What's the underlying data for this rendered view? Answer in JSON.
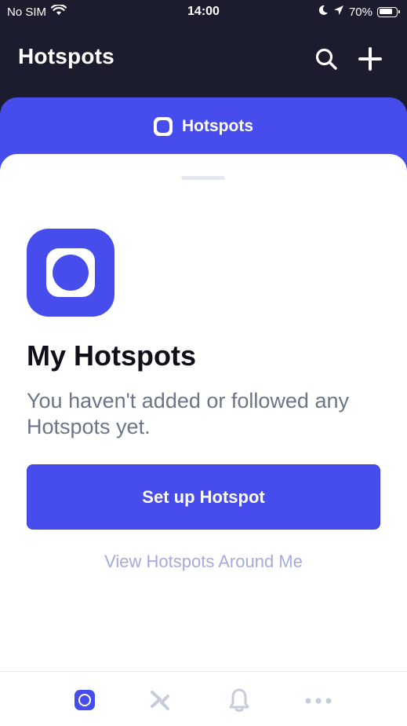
{
  "status_bar": {
    "carrier": "No SIM",
    "time": "14:00",
    "battery_percent": "70%",
    "icons": [
      "wifi-icon",
      "moon-icon",
      "location-arrow-icon",
      "battery-icon"
    ]
  },
  "header": {
    "title": "Hotspots",
    "actions": [
      "search-icon",
      "plus-icon"
    ]
  },
  "tab_sheet": {
    "label": "Hotspots",
    "icon": "hotspot-icon"
  },
  "empty_state": {
    "icon": "hotspot-icon",
    "title": "My Hotspots",
    "description": "You haven't added or followed any Hotspots yet.",
    "primary_button": "Set up Hotspot",
    "secondary_link": "View Hotspots Around Me"
  },
  "tab_bar": {
    "items": [
      {
        "icon": "hotspot-icon",
        "active": true
      },
      {
        "icon": "transfer-icon",
        "active": false
      },
      {
        "icon": "bell-icon",
        "active": false
      },
      {
        "icon": "more-icon",
        "active": false
      }
    ]
  },
  "colors": {
    "header_bg": "#1b1d2e",
    "accent": "#474dec",
    "text_dark": "#0e0f19",
    "text_muted": "#6b7489",
    "link_muted": "#a4aadc",
    "inactive_icon": "#c6ccd8"
  }
}
